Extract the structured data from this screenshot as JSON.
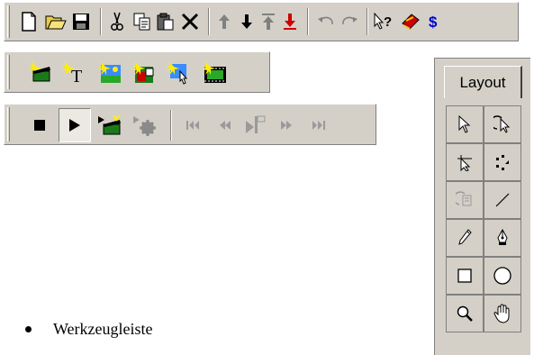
{
  "toolbars": {
    "standard": {
      "buttons": [
        "new-file",
        "open-folder",
        "save",
        "cut",
        "copy",
        "paste",
        "delete",
        "move-up",
        "move-down",
        "move-top",
        "move-bottom",
        "undo",
        "redo",
        "help",
        "book",
        "currency"
      ]
    },
    "insert": {
      "buttons": [
        "insert-clip",
        "insert-text",
        "insert-image",
        "insert-shape",
        "insert-interaction",
        "insert-film"
      ]
    },
    "playback": {
      "buttons": [
        "stop",
        "play",
        "play-clip",
        "play-gear",
        "go-first",
        "rewind",
        "play-frame",
        "fast-forward",
        "go-last"
      ]
    }
  },
  "layout_panel": {
    "tab_label": "Layout",
    "tools": [
      "select-arrow-icon",
      "rotate-select-icon",
      "node-select-icon",
      "transform-icon",
      "grayed-rotate-icon",
      "line-icon",
      "pencil-icon",
      "pen-icon",
      "rectangle-icon",
      "ellipse-icon",
      "zoom-icon",
      "hand-icon"
    ]
  },
  "bullet": {
    "text": "Werkzeugleiste"
  },
  "colors": {
    "toolbar_bg": "#d4d0c8",
    "accent_blue": "#0000cc",
    "accent_red": "#cc0000"
  }
}
